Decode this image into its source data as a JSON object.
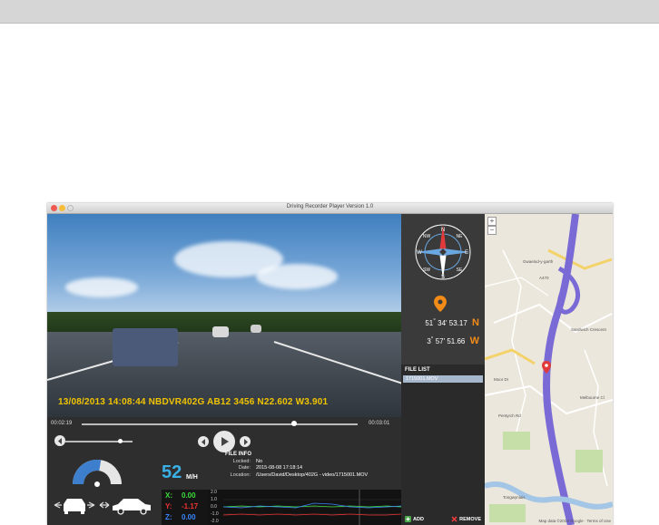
{
  "window": {
    "title": "Driving Recorder Player Version 1.0"
  },
  "video": {
    "overlay_text": "13/08/2013  14:08:44  NBDVR402G  AB12 3456  N22.602  W3.901"
  },
  "compass": {
    "letters": [
      "N",
      "NE",
      "E",
      "SE",
      "S",
      "SW",
      "W",
      "NW"
    ],
    "heading_deg": 0
  },
  "gps": {
    "latitude": {
      "deg": "51",
      "min": "34",
      "sec": "53.17",
      "dir": "N"
    },
    "longitude": {
      "deg": "3",
      "min": "57",
      "sec": "51.66",
      "dir": "W"
    },
    "pin_color": "#f28b18"
  },
  "file_list": {
    "title": "FILE LIST",
    "items": [
      "1715001.MOV"
    ],
    "add_label": "ADD",
    "remove_label": "REMOVE"
  },
  "map": {
    "zoom_in": "+",
    "zoom_out": "−",
    "labels": [
      "Gwaelod-y-garth",
      "Sandwich Crescent",
      "A470",
      "Melbourne Cl",
      "Moor Dr",
      "Pentyrch Rd",
      "Tongwynlais"
    ],
    "credit": "Map data ©2013 Google · Terms of Use"
  },
  "playback": {
    "current_time": "00:02:19",
    "total_time": "00:03:01",
    "progress": 0.77,
    "volume": 0.82
  },
  "speed": {
    "value": "52",
    "unit": "M/H",
    "gauge_fraction": 0.55
  },
  "gsensor": {
    "x": {
      "label": "X:",
      "value": "0.00",
      "color": "#3ddc3d"
    },
    "y": {
      "label": "Y:",
      "value": "-1.17",
      "color": "#ee3333"
    },
    "z": {
      "label": "Z:",
      "value": "0.00",
      "color": "#3a86ff"
    },
    "ticks": [
      "2.0",
      "1.0",
      "0.0",
      "-1.0",
      "-2.0"
    ]
  },
  "file_info": {
    "title": "FILE INFO",
    "locked_label": "Locked:",
    "locked_value": "No",
    "date_label": "Date:",
    "date_value": "2015-08-08 17:18:14",
    "location_label": "Location:",
    "location_value": "/Users/David/Desktop/402G - video/1715001.MOV"
  }
}
